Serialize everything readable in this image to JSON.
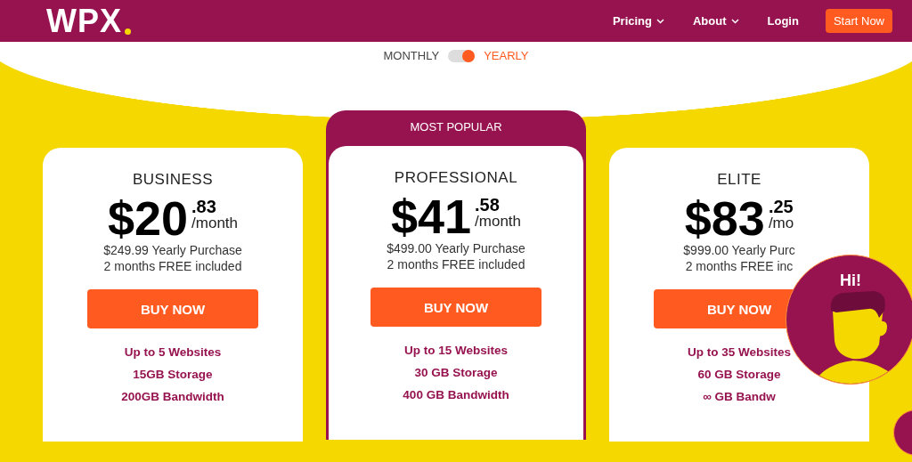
{
  "header": {
    "logo": "WPX",
    "nav": [
      {
        "label": "Pricing",
        "kind": "dropdown"
      },
      {
        "label": "About",
        "kind": "dropdown"
      },
      {
        "label": "Login",
        "kind": "link"
      },
      {
        "label": "Start Now",
        "kind": "button"
      }
    ]
  },
  "billing": {
    "options": [
      {
        "label": "MONTHLY",
        "selected": false
      },
      {
        "label": "YEARLY",
        "selected": true
      }
    ]
  },
  "plans": [
    {
      "name": "BUSINESS",
      "price": "$20",
      "cents": ".83",
      "period": "/month",
      "yearly": "$249.99 Yearly Purchase",
      "free": "2 months FREE included",
      "button": "BUY NOW",
      "features": [
        "Up to 5 Websites",
        "15GB Storage",
        "200GB Bandwidth"
      ]
    },
    {
      "name": "PROFESSIONAL",
      "banner": "MOST POPULAR",
      "price": "$41",
      "cents": ".58",
      "period": "/month",
      "yearly": "$499.00 Yearly Purchase",
      "free": "2 months FREE included",
      "button": "BUY NOW",
      "features": [
        "Up to 15 Websites",
        "30 GB Storage",
        "400 GB Bandwidth"
      ]
    },
    {
      "name": "ELITE",
      "price": "$83",
      "cents": ".25",
      "period": "/mo",
      "yearly": "$999.00 Yearly Purc",
      "free": "2 months FREE inc",
      "button": "BUY NOW",
      "features": [
        "Up to 35 Websites",
        "60 GB Storage",
        "∞ GB Bandw"
      ]
    }
  ],
  "chat": {
    "greeting": "Hi!"
  }
}
